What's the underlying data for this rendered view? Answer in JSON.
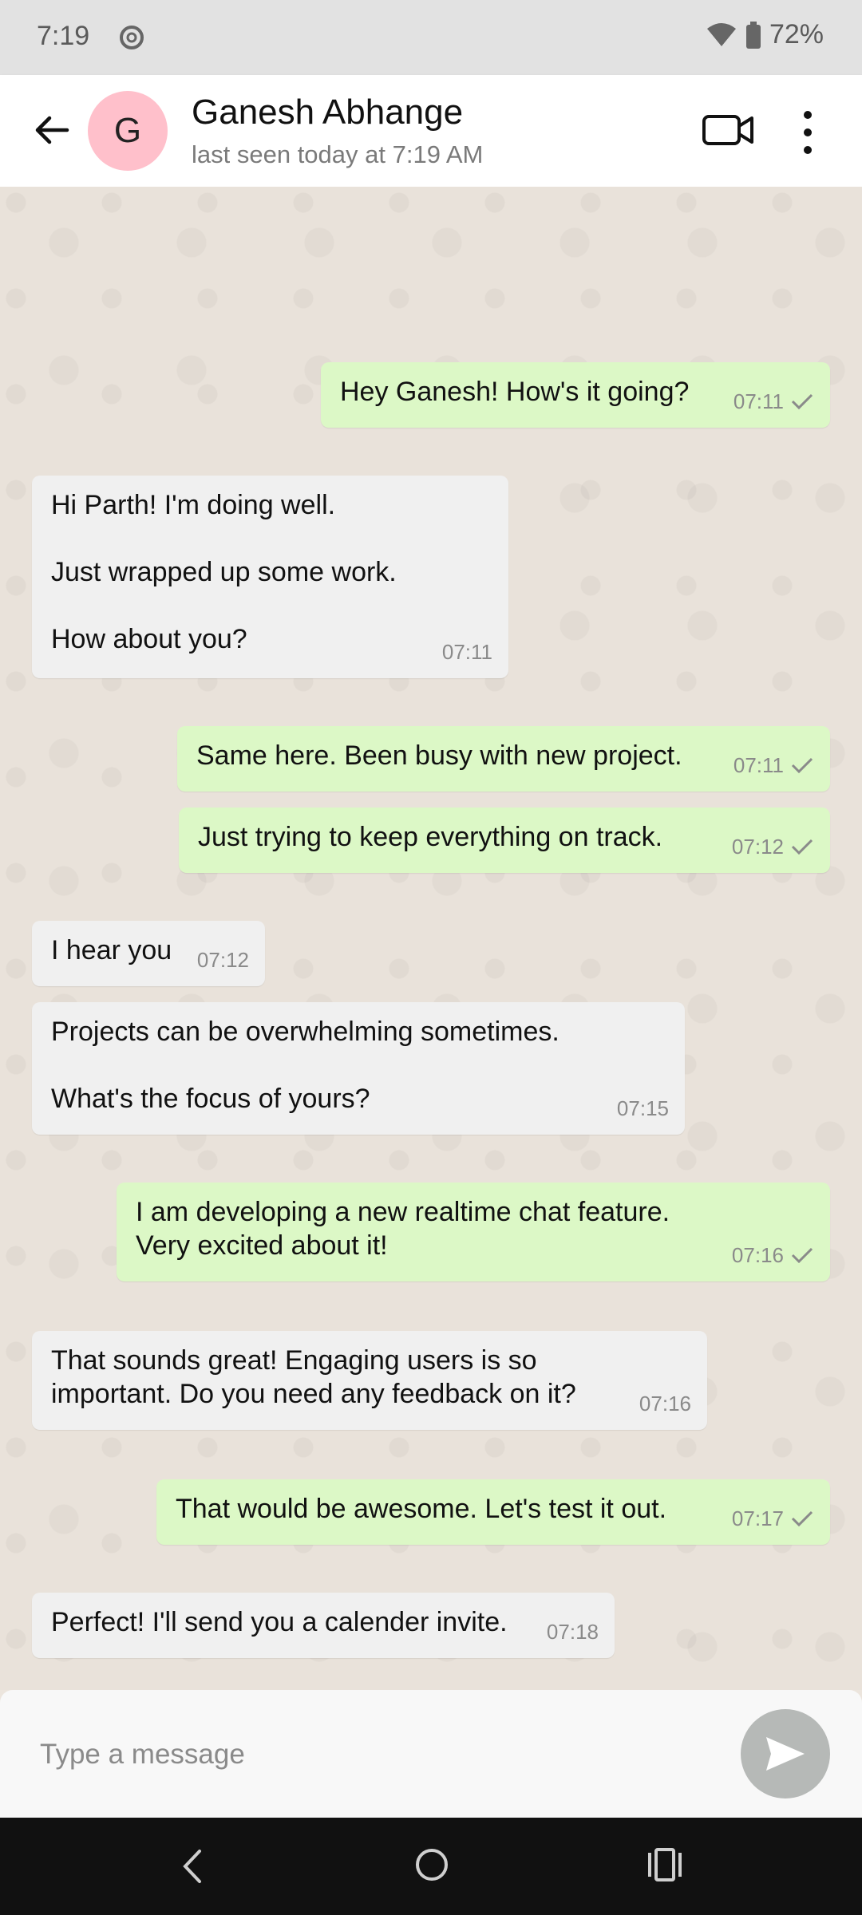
{
  "status_bar": {
    "time": "7:19",
    "battery": "72%"
  },
  "header": {
    "avatar_letter": "G",
    "name": "Ganesh Abhange",
    "last_seen": "last seen today at 7:19 AM"
  },
  "messages": [
    {
      "direction": "out",
      "text": "Hey Ganesh! How's it going?",
      "time": "07:11",
      "status": "sent"
    },
    {
      "direction": "in",
      "text": "Hi Parth! I'm doing well.\n\nJust wrapped up some work.\n\nHow about you?",
      "time": "07:11"
    },
    {
      "direction": "out",
      "text": "Same here. Been busy with new project.",
      "time": "07:11",
      "status": "sent"
    },
    {
      "direction": "out",
      "text": "Just trying to keep everything on track.",
      "time": "07:12",
      "status": "sent"
    },
    {
      "direction": "in",
      "text": "I hear you",
      "time": "07:12"
    },
    {
      "direction": "in",
      "text": "Projects can be overwhelming sometimes.\n\nWhat's the focus of yours?",
      "time": "07:15"
    },
    {
      "direction": "out",
      "text": "I am developing a new realtime chat feature.\nVery excited about it!",
      "time": "07:16",
      "status": "sent"
    },
    {
      "direction": "in",
      "text": "That sounds great! Engaging users is so\nimportant. Do you need any feedback on it?",
      "time": "07:16"
    },
    {
      "direction": "out",
      "text": "That would be awesome. Let's test it out.",
      "time": "07:17",
      "status": "sent"
    },
    {
      "direction": "in",
      "text": "Perfect! I'll send you a calender invite.",
      "time": "07:18"
    }
  ],
  "composer": {
    "placeholder": "Type a message",
    "value": ""
  },
  "colors": {
    "outgoing_bubble": "#dcf8c6",
    "incoming_bubble": "#f0f0f0",
    "avatar_bg": "#ffc0cb"
  }
}
